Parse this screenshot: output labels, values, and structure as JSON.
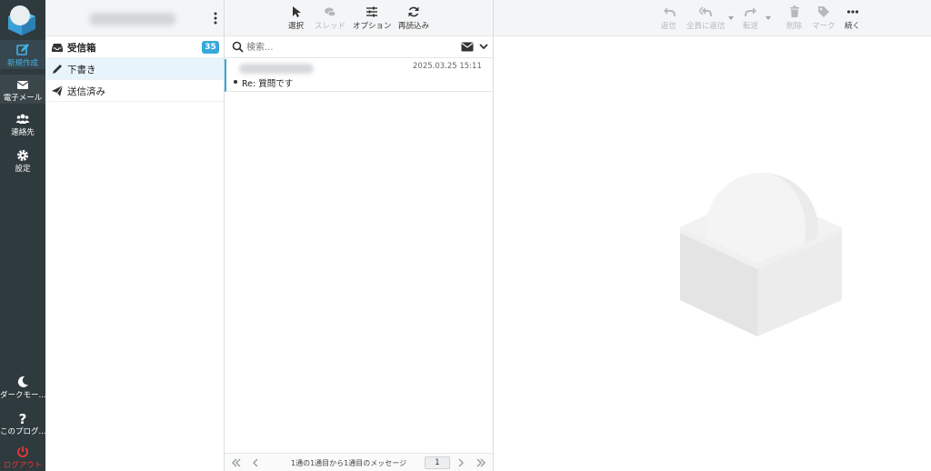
{
  "nav": {
    "compose": "新規作成",
    "mail": "電子メール",
    "contacts": "連絡先",
    "settings": "設定",
    "dark_mode": "ダークモー...",
    "about": "このプログ...",
    "logout": "ログアウト"
  },
  "folders": [
    {
      "label": "受信箱",
      "badge": "35"
    },
    {
      "label": "下書き"
    },
    {
      "label": "送信済み"
    }
  ],
  "list_toolbar": {
    "select": "選択",
    "thread": "スレッド",
    "options": "オプション",
    "refresh": "再読込み"
  },
  "search": {
    "placeholder": "検索..."
  },
  "messages": [
    {
      "date": "2025.03.25 15:11",
      "subject": "Re: 質問です"
    }
  ],
  "pager": {
    "info": "1通の1通目から1通目のメッセージ",
    "page": "1"
  },
  "preview_toolbar": {
    "reply": "返信",
    "reply_all": "全員に返信",
    "forward": "転送",
    "delete": "削除",
    "mark": "マーク",
    "more": "続く"
  },
  "colors": {
    "nav_bg": "#2f3a3f",
    "accent": "#37a8d9",
    "logout": "#e53935",
    "selected_row": "#e8f4fb"
  }
}
